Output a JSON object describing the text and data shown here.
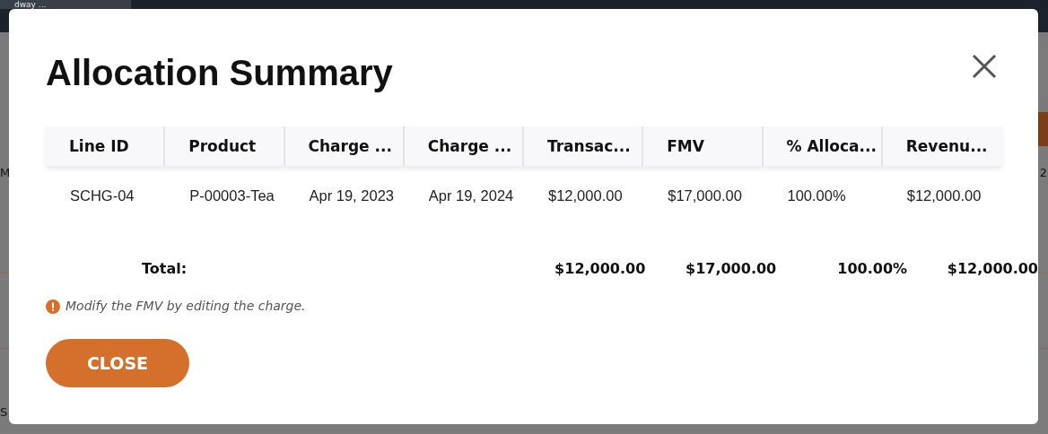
{
  "background": {
    "tab_label": "dway ...",
    "fragments": [
      "M",
      "2",
      "S"
    ]
  },
  "modal": {
    "title": "Allocation Summary",
    "table": {
      "columns": [
        "Line ID",
        "Product",
        "Charge ...",
        "Charge ...",
        "Transac...",
        "FMV",
        "% Alloca...",
        "Revenu..."
      ],
      "rows": [
        [
          "SCHG-04",
          "P-00003-Tea",
          "Apr 19, 2023",
          "Apr 19, 2024",
          "$12,000.00",
          "$17,000.00",
          "100.00%",
          "$12,000.00"
        ]
      ]
    },
    "totals": {
      "label": "Total:",
      "values": [
        "$12,000.00",
        "$17,000.00",
        "100.00%",
        "$12,000.00"
      ]
    },
    "note": "Modify the FMV by editing the charge.",
    "buttons": [
      "CLOSE"
    ]
  }
}
